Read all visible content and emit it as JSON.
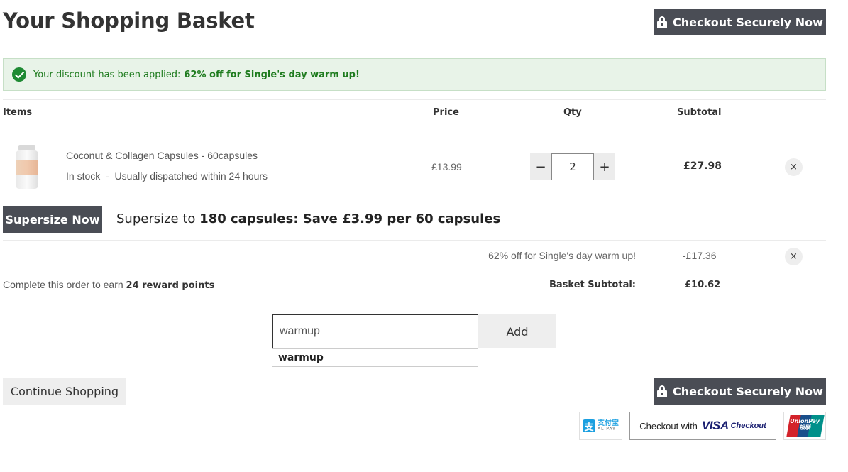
{
  "header": {
    "title": "Your Shopping Basket",
    "checkout_label": "Checkout Securely Now"
  },
  "notice": {
    "text": "Your discount has been applied:",
    "highlight": "62% off for Single's day warm up!"
  },
  "table": {
    "columns": [
      "Items",
      "Price",
      "Qty",
      "Subtotal"
    ]
  },
  "item": {
    "name": "Coconut & Collagen Capsules - 60capsules",
    "stock": "In stock  -  Usually dispatched within 24 hours",
    "price": "£13.99",
    "qty": "2",
    "qty_minus": "−",
    "qty_plus": "+",
    "subtotal": "£27.98",
    "remove": "×"
  },
  "supersize": {
    "button": "Supersize Now",
    "text_prefix": "Supersize to",
    "text_bold": "180 capsules: Save £3.99 per 60 capsules"
  },
  "discount": {
    "label": "62% off for Single's day warm up!",
    "value": "-£17.36",
    "remove": "×"
  },
  "reward": {
    "prefix": "Complete this order to earn",
    "points": "24 reward points"
  },
  "basket_subtotal": {
    "label": "Basket Subtotal:",
    "value": "£10.62"
  },
  "promo": {
    "value": "warmup",
    "add_label": "Add",
    "suggestion": "warmup"
  },
  "footer": {
    "continue_label": "Continue Shopping",
    "checkout_label": "Checkout Securely Now",
    "alipay_cn": "支付宝",
    "alipay_en": "ALIPAY",
    "alipay_mark": "支",
    "visa_prefix": "Checkout with",
    "visa_brand": "VISA",
    "visa_suffix": "Checkout",
    "unionpay_en": "UnionPay",
    "unionpay_cn": "银联"
  },
  "colors": {
    "accent_dark": "#4a4d55",
    "success_bg": "#e8f3e8",
    "success_text": "#1e7b1e",
    "visa_blue": "#1a1f71"
  }
}
